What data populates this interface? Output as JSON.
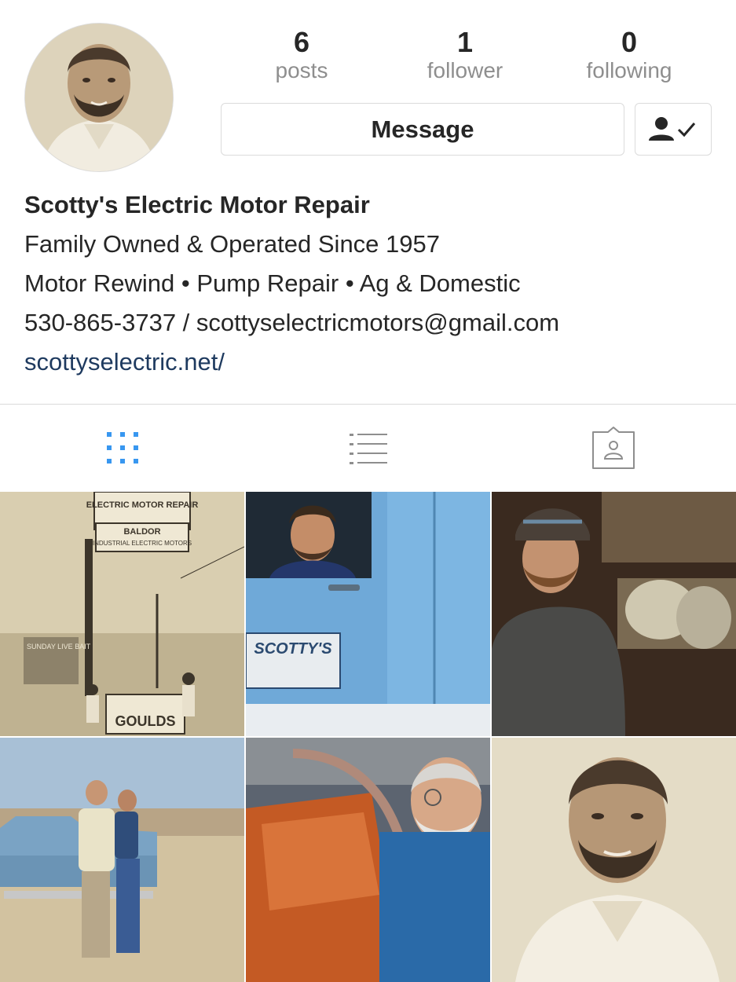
{
  "profile": {
    "name": "Scotty's Electric Motor Repair",
    "bio_lines": [
      "Family Owned & Operated Since 1957",
      "Motor Rewind • Pump Repair • Ag & Domestic",
      "530-865-3737 / scottyselectricmotors@gmail.com"
    ],
    "website": "scottyselectric.net/"
  },
  "stats": [
    {
      "value": "6",
      "label": "posts"
    },
    {
      "value": "1",
      "label": "follower"
    },
    {
      "value": "0",
      "label": "following"
    }
  ],
  "actions": {
    "message_label": "Message",
    "follow_icon": "person-check-icon"
  },
  "tabs": [
    {
      "icon": "grid-icon",
      "active": true
    },
    {
      "icon": "list-icon",
      "active": false
    },
    {
      "icon": "tagged-icon",
      "active": false
    }
  ],
  "colors": {
    "active_tab": "#3897f0",
    "inactive_tab": "#8e8e8e",
    "link": "#1e3a5f",
    "muted": "#8e8e8e"
  },
  "posts": [
    {
      "description": "vintage sepia photo of Scotty's Electric sign",
      "sign_text": "ELECTRIC MOTOR REPAIR",
      "sign_text_2": "BALDOR",
      "sign_text_3": "INDUSTRIAL ELECTRIC MOTORS",
      "sign_text_4": "SUNDAY LIVE BAIT",
      "sign_text_5": "GOULDS"
    },
    {
      "description": "man in blue truck with Scotty's door logo",
      "door_text": "SCOTTY'S"
    },
    {
      "description": "bearded man in cap in workshop"
    },
    {
      "description": "two men leaning on vintage car"
    },
    {
      "description": "older man working on motor winding"
    },
    {
      "description": "sepia portrait of bearded man"
    }
  ]
}
